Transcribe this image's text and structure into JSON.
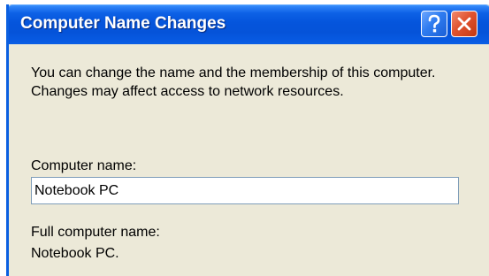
{
  "window": {
    "title": "Computer Name Changes",
    "help_icon": "question-mark",
    "close_icon": "x-mark"
  },
  "dialog": {
    "description": "You can change the name and the membership of this computer. Changes may affect access to network resources.",
    "computer_name_label": "Computer name:",
    "computer_name_value": "Notebook PC",
    "full_name_label": "Full computer name:",
    "full_name_value": "Notebook PC."
  },
  "colors": {
    "titlebar": "#0555dc",
    "window_bg": "#ece9d8",
    "close_button": "#e0532f",
    "input_border": "#7f9db9"
  }
}
